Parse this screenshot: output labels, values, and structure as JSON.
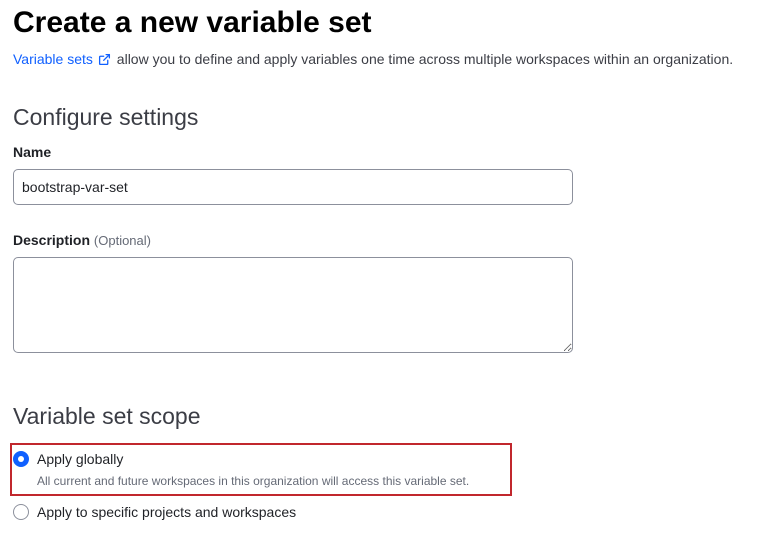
{
  "page": {
    "title": "Create a new variable set",
    "intro_link": "Variable sets",
    "intro_link_icon": "external-link-icon",
    "intro_text": "allow you to define and apply variables one time across multiple workspaces within an organization."
  },
  "configure": {
    "heading": "Configure settings",
    "name_label": "Name",
    "name_value": "bootstrap-var-set",
    "description_label": "Description",
    "description_optional": "(Optional)",
    "description_value": ""
  },
  "scope": {
    "heading": "Variable set scope",
    "options": [
      {
        "label": "Apply globally",
        "help": "All current and future workspaces in this organization will access this variable set.",
        "selected": true
      },
      {
        "label": "Apply to specific projects and workspaces",
        "selected": false
      }
    ],
    "highlight_color": "#c1272d"
  },
  "colors": {
    "link": "#1060ff",
    "radio_selected": "#1060ff"
  }
}
